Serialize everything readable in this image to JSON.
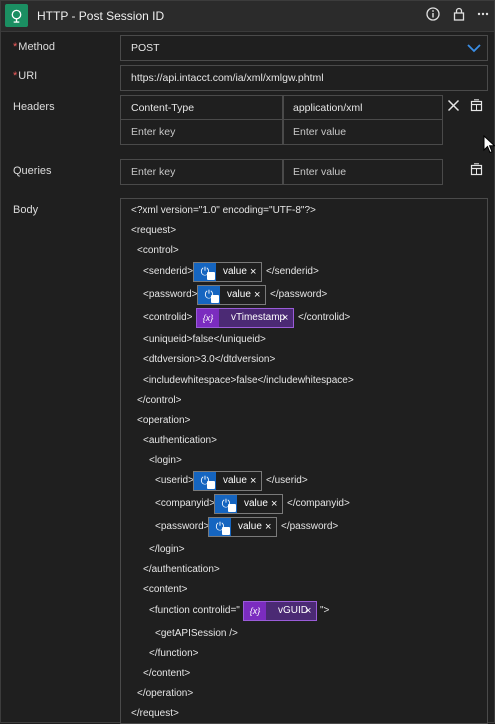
{
  "header": {
    "title": "HTTP - Post Session ID"
  },
  "method": {
    "label": "Method",
    "value": "POST"
  },
  "uri": {
    "label": "URI",
    "value": "https://api.intacct.com/ia/xml/xmlgw.phtml"
  },
  "headers": {
    "label": "Headers",
    "rows": [
      {
        "key": "Content-Type",
        "value": "application/xml"
      }
    ],
    "new_key_placeholder": "Enter key",
    "new_value_placeholder": "Enter value"
  },
  "queries": {
    "label": "Queries",
    "key_placeholder": "Enter key",
    "value_placeholder": "Enter value"
  },
  "body": {
    "label": "Body",
    "l1": "<?xml version=\"1.0\" encoding=\"UTF-8\"?>",
    "l2": "<request>",
    "l3": "<control>",
    "l4a": "<senderid>",
    "l4b": "</senderid>",
    "l5a": "<password>",
    "l5b": "</password>",
    "l6a": "<controlid>",
    "l6b": "</controlid>",
    "l7": "<uniqueid>false</uniqueid>",
    "l8": "<dtdversion>3.0</dtdversion>",
    "l9": "<includewhitespace>false</includewhitespace>",
    "l10": "</control>",
    "l11": "<operation>",
    "l12": "<authentication>",
    "l13": "<login>",
    "l14a": "<userid>",
    "l14b": "</userid>",
    "l15a": "<companyid>",
    "l15b": "</companyid>",
    "l16a": "<password>",
    "l16b": "</password>",
    "l17": "</login>",
    "l18": "</authentication>",
    "l19": "<content>",
    "l20a": "<function controlid=\"",
    "l20b": "\">",
    "l21": "<getAPISession />",
    "l22": "</function>",
    "l23": "</content>",
    "l24": "</operation>",
    "l25": "</request>",
    "token_value": "value",
    "token_timestamp": "vTimestamp",
    "token_guid": "vGUID",
    "var_glyph": "{x}"
  }
}
